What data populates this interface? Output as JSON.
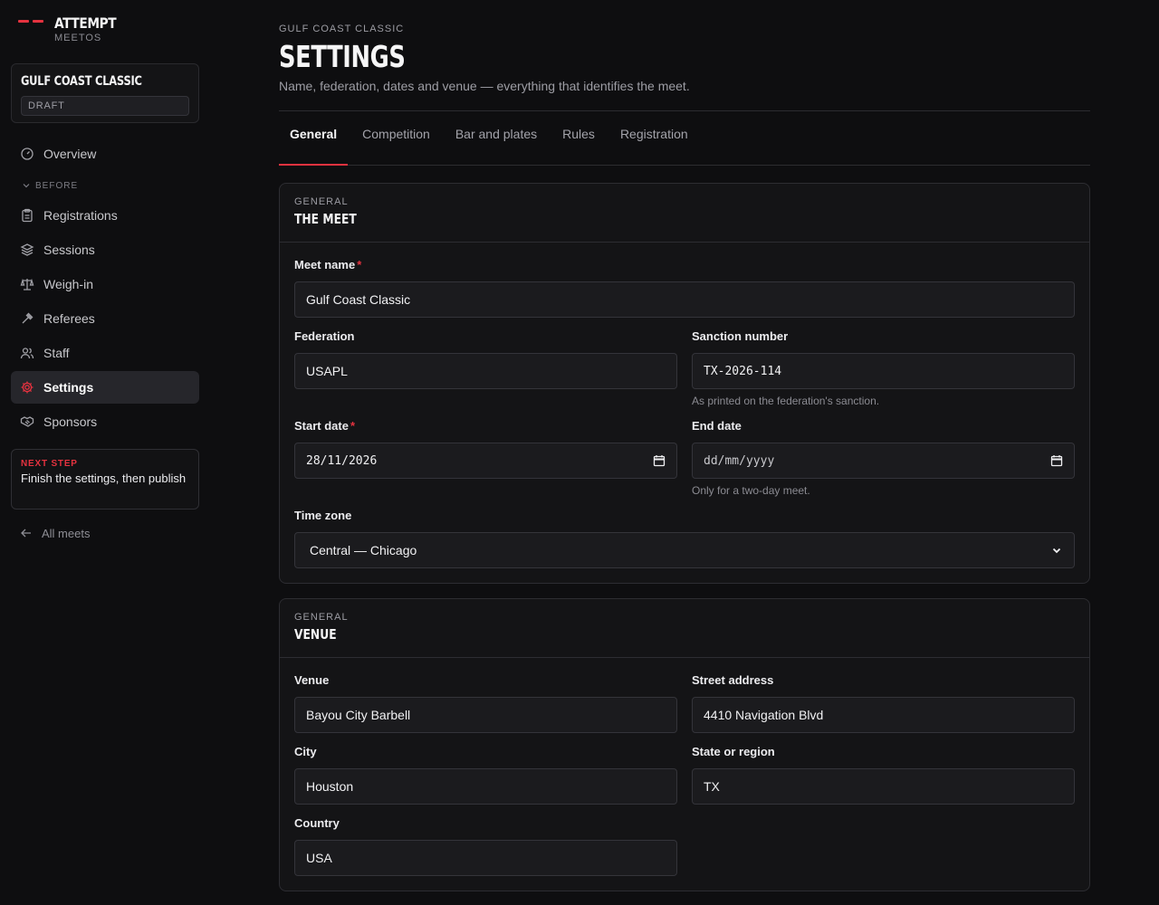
{
  "brand": {
    "name": "ATTEMPT",
    "sub": "MEETOS"
  },
  "meet": {
    "name": "GULF COAST CLASSIC",
    "status": "DRAFT"
  },
  "nav": {
    "overview": "Overview",
    "section_before": "BEFORE",
    "items": [
      {
        "label": "Registrations",
        "icon": "clipboard-icon"
      },
      {
        "label": "Sessions",
        "icon": "layers-icon"
      },
      {
        "label": "Weigh-in",
        "icon": "scale-icon"
      },
      {
        "label": "Referees",
        "icon": "gavel-icon"
      },
      {
        "label": "Staff",
        "icon": "users-icon"
      },
      {
        "label": "Settings",
        "icon": "gear-icon",
        "active": true
      },
      {
        "label": "Sponsors",
        "icon": "handshake-icon"
      }
    ]
  },
  "next_step": {
    "label": "NEXT STEP",
    "text": "Finish the settings, then publish"
  },
  "back_link": "All meets",
  "header": {
    "eyebrow": "GULF COAST CLASSIC",
    "title": "SETTINGS",
    "subtitle": "Name, federation, dates and venue — everything that identifies the meet."
  },
  "tabs": [
    "General",
    "Competition",
    "Bar and plates",
    "Rules",
    "Registration"
  ],
  "cards": {
    "meet": {
      "eyebrow": "GENERAL",
      "title": "THE MEET",
      "meet_name": {
        "label": "Meet name",
        "value": "Gulf Coast Classic"
      },
      "federation": {
        "label": "Federation",
        "value": "USAPL"
      },
      "sanction": {
        "label": "Sanction number",
        "value": "TX-2026-114",
        "hint": "As printed on the federation's sanction."
      },
      "start_date": {
        "label": "Start date",
        "value": "28/11/2026"
      },
      "end_date": {
        "label": "End date",
        "placeholder": "dd/mm/yyyy",
        "hint": "Only for a two-day meet."
      },
      "timezone": {
        "label": "Time zone",
        "value": "Central — Chicago"
      }
    },
    "venue": {
      "eyebrow": "GENERAL",
      "title": "VENUE",
      "venue": {
        "label": "Venue",
        "value": "Bayou City Barbell"
      },
      "street": {
        "label": "Street address",
        "value": "4410 Navigation Blvd"
      },
      "city": {
        "label": "City",
        "value": "Houston"
      },
      "state": {
        "label": "State or region",
        "value": "TX"
      },
      "country": {
        "label": "Country",
        "value": "USA"
      }
    }
  },
  "colors": {
    "accent": "#e5323f",
    "background": "#0e0e10",
    "card": "#141416"
  }
}
